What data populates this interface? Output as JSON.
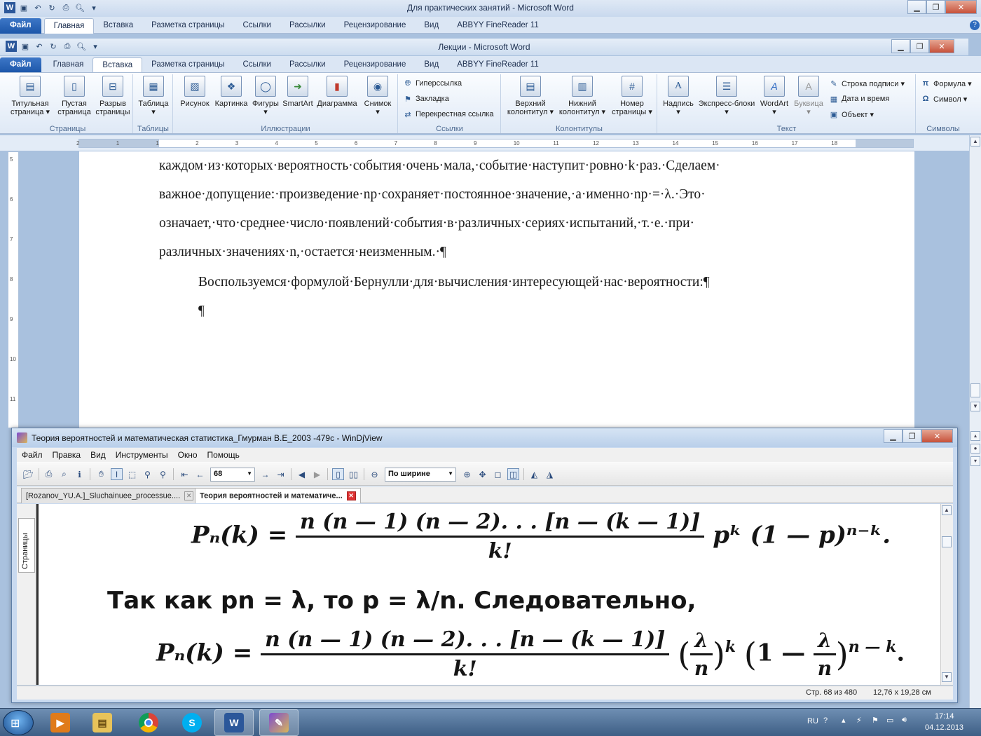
{
  "outer_word": {
    "title": "Для практических занятий  -  Microsoft Word",
    "tabs": [
      "Файл",
      "Главная",
      "Вставка",
      "Разметка страницы",
      "Ссылки",
      "Рассылки",
      "Рецензирование",
      "Вид",
      "ABBYY FineReader 11"
    ],
    "active_tab": "Главная"
  },
  "inner_word": {
    "title": "Лекции  -  Microsoft Word",
    "tabs": [
      "Файл",
      "Главная",
      "Вставка",
      "Разметка страницы",
      "Ссылки",
      "Рассылки",
      "Рецензирование",
      "Вид",
      "ABBYY FineReader 11"
    ],
    "active_tab": "Вставка"
  },
  "ribbon": {
    "groups": {
      "pages": "Страницы",
      "tables": "Таблицы",
      "illustrations": "Иллюстрации",
      "links": "Ссылки",
      "header_footer": "Колонтитулы",
      "text": "Текст",
      "symbols": "Символы"
    },
    "pages_buttons": [
      {
        "label": "Титульная\nстраница ▾",
        "icon": "cover-page-icon"
      },
      {
        "label": "Пустая\nстраница",
        "icon": "blank-page-icon"
      },
      {
        "label": "Разрыв\nстраницы",
        "icon": "page-break-icon"
      }
    ],
    "table_button": {
      "label": "Таблица\n▾",
      "icon": "table-icon"
    },
    "illustration_buttons": [
      {
        "label": "Рисунок",
        "icon": "picture-icon"
      },
      {
        "label": "Картинка",
        "icon": "clipart-icon"
      },
      {
        "label": "Фигуры\n▾",
        "icon": "shapes-icon"
      },
      {
        "label": "SmartArt",
        "icon": "smartart-icon"
      },
      {
        "label": "Диаграмма",
        "icon": "chart-icon"
      },
      {
        "label": "Снимок\n▾",
        "icon": "screenshot-icon"
      }
    ],
    "links_items": [
      "Гиперссылка",
      "Закладка",
      "Перекрестная ссылка"
    ],
    "header_footer_buttons": [
      {
        "label": "Верхний\nколонтитул ▾",
        "icon": "header-icon"
      },
      {
        "label": "Нижний\nколонтитул ▾",
        "icon": "footer-icon"
      },
      {
        "label": "Номер\nстраницы ▾",
        "icon": "page-number-icon"
      }
    ],
    "text_buttons": [
      {
        "label": "Надпись\n▾",
        "icon": "textbox-icon"
      },
      {
        "label": "Экспресс-блоки\n▾",
        "icon": "quickparts-icon"
      },
      {
        "label": "WordArt\n▾",
        "icon": "wordart-icon"
      },
      {
        "label": "Буквица\n▾",
        "icon": "dropcap-icon"
      }
    ],
    "text_small": [
      "Строка подписи ▾",
      "Дата и время",
      "Объект ▾"
    ],
    "symbols_items": [
      "Формула ▾",
      "Символ ▾"
    ]
  },
  "ruler": {
    "h_ticks": [
      "2",
      "1",
      "1",
      "2",
      "3",
      "4",
      "5",
      "6",
      "7",
      "8",
      "9",
      "10",
      "11",
      "12",
      "13",
      "14",
      "15",
      "16",
      "17",
      "18"
    ],
    "v_ticks": [
      "5",
      "6",
      "7",
      "8",
      "9",
      "10",
      "11"
    ]
  },
  "document": {
    "line1": "каждом·из·которых·вероятность·события·очень·мала,·событие·наступит·ровно·k·раз.·Сделаем·",
    "line2": "важное·допущение:·произведение·np·сохраняет·постоянное·значение,·а·именно·np·=·λ.·Это·",
    "line3": "означает,·что·среднее·число·появлений·события·в·различных·сериях·испытаний,·т.·е.·при·",
    "line4": "различных·значениях·n,·остается·неизменным.·¶",
    "line5": "Воспользуемся·формулой·Бернулли·для·вычисления·интересующей·нас·вероятности:¶",
    "line6": "¶"
  },
  "djview": {
    "title": "Теория вероятностей и математическая статистика_Гмурман В.Е_2003 -479с - WinDjView",
    "menu": [
      "Файл",
      "Правка",
      "Вид",
      "Инструменты",
      "Окно",
      "Помощь"
    ],
    "page_input": "68",
    "zoom_select": "По ширине",
    "tabs": [
      "[Rozanov_YU.A.]_Sluchainuee_processue....",
      "Теория вероятностей и математиче..."
    ],
    "side_tab": "Страницы",
    "page_status": "Стр. 68 из 480",
    "size_status": "12,76 x 19,28 см",
    "content": {
      "formula1_lhs": "Pₙ(k) =",
      "formula1_num": "n (n — 1) (n — 2). . . [n — (k — 1)]",
      "formula1_den": "k!",
      "formula1_rhs": "pᵏ (1 — p)ⁿ⁻ᵏ.",
      "text_line": "Так  как  pn = λ,  то  p = λ/n.  Следовательно,",
      "formula2_lhs": "Pₙ(k) =",
      "formula2_num": "n (n — 1) (n — 2). . . [n — (k — 1)]",
      "formula2_den": "k!",
      "formula2_f1_num": "λ",
      "formula2_f1_den": "n",
      "formula2_f1_exp": "k",
      "formula2_one": "1 —",
      "formula2_f2_num": "λ",
      "formula2_f2_den": "n",
      "formula2_f2_exp": "n — k",
      "formula2_end": "."
    }
  },
  "taskbar": {
    "apps": [
      "media-player-icon",
      "explorer-icon",
      "chrome-icon",
      "skype-icon",
      "word-icon",
      "windjview-icon"
    ],
    "lang": "RU",
    "time": "17:14",
    "date": "04.12.2013"
  }
}
